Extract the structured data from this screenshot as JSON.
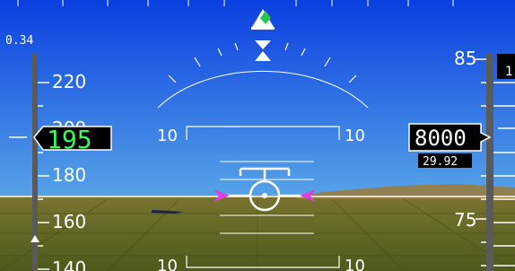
{
  "colors": {
    "sky_top": "#0a3fe0",
    "sky_bottom": "#4a9be6",
    "ground_top": "#6f6a2a",
    "ground_bottom": "#4e5a1c",
    "speed_box_text": "#33ff55",
    "chevron_magenta": "#e23be0",
    "symbology": "#ffffff"
  },
  "mach": {
    "value": "0.34"
  },
  "speed_tape": {
    "labels": [
      "220",
      "200",
      "180",
      "160",
      "140"
    ],
    "current": "195"
  },
  "altitude_tape": {
    "label_upper": "85",
    "label_lower": "75",
    "label_edge": "1",
    "current": "8000",
    "baro": "29.92"
  },
  "pitch_ladder": {
    "upper_left": "10",
    "upper_right": "10",
    "lower_left": "10",
    "lower_right": "10"
  },
  "icons": {
    "flight_director": "flight-director-icon",
    "roll_pointer": "roll-pointer-icon",
    "aircraft": "aircraft-symbol-icon",
    "speed_trend": "speed-trend-icon"
  }
}
